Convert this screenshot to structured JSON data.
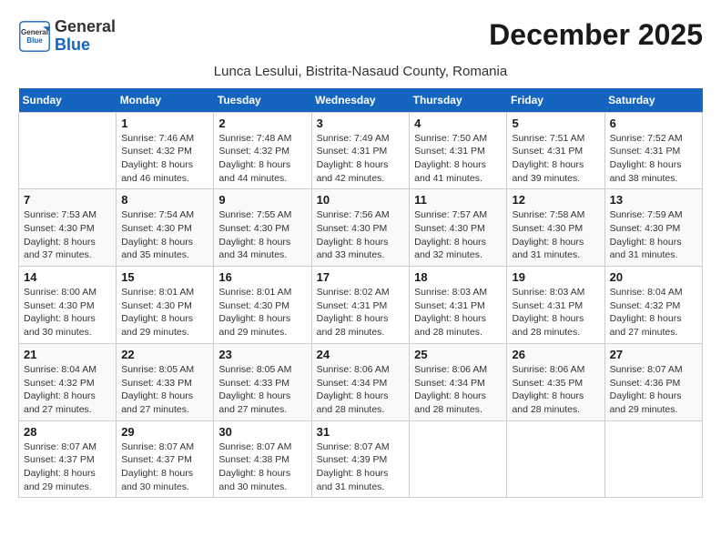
{
  "header": {
    "logo_general": "General",
    "logo_blue": "Blue",
    "month_title": "December 2025",
    "location": "Lunca Lesului, Bistrita-Nasaud County, Romania"
  },
  "weekdays": [
    "Sunday",
    "Monday",
    "Tuesday",
    "Wednesday",
    "Thursday",
    "Friday",
    "Saturday"
  ],
  "weeks": [
    [
      {
        "day": "",
        "info": ""
      },
      {
        "day": "1",
        "info": "Sunrise: 7:46 AM\nSunset: 4:32 PM\nDaylight: 8 hours\nand 46 minutes."
      },
      {
        "day": "2",
        "info": "Sunrise: 7:48 AM\nSunset: 4:32 PM\nDaylight: 8 hours\nand 44 minutes."
      },
      {
        "day": "3",
        "info": "Sunrise: 7:49 AM\nSunset: 4:31 PM\nDaylight: 8 hours\nand 42 minutes."
      },
      {
        "day": "4",
        "info": "Sunrise: 7:50 AM\nSunset: 4:31 PM\nDaylight: 8 hours\nand 41 minutes."
      },
      {
        "day": "5",
        "info": "Sunrise: 7:51 AM\nSunset: 4:31 PM\nDaylight: 8 hours\nand 39 minutes."
      },
      {
        "day": "6",
        "info": "Sunrise: 7:52 AM\nSunset: 4:31 PM\nDaylight: 8 hours\nand 38 minutes."
      }
    ],
    [
      {
        "day": "7",
        "info": "Sunrise: 7:53 AM\nSunset: 4:30 PM\nDaylight: 8 hours\nand 37 minutes."
      },
      {
        "day": "8",
        "info": "Sunrise: 7:54 AM\nSunset: 4:30 PM\nDaylight: 8 hours\nand 35 minutes."
      },
      {
        "day": "9",
        "info": "Sunrise: 7:55 AM\nSunset: 4:30 PM\nDaylight: 8 hours\nand 34 minutes."
      },
      {
        "day": "10",
        "info": "Sunrise: 7:56 AM\nSunset: 4:30 PM\nDaylight: 8 hours\nand 33 minutes."
      },
      {
        "day": "11",
        "info": "Sunrise: 7:57 AM\nSunset: 4:30 PM\nDaylight: 8 hours\nand 32 minutes."
      },
      {
        "day": "12",
        "info": "Sunrise: 7:58 AM\nSunset: 4:30 PM\nDaylight: 8 hours\nand 31 minutes."
      },
      {
        "day": "13",
        "info": "Sunrise: 7:59 AM\nSunset: 4:30 PM\nDaylight: 8 hours\nand 31 minutes."
      }
    ],
    [
      {
        "day": "14",
        "info": "Sunrise: 8:00 AM\nSunset: 4:30 PM\nDaylight: 8 hours\nand 30 minutes."
      },
      {
        "day": "15",
        "info": "Sunrise: 8:01 AM\nSunset: 4:30 PM\nDaylight: 8 hours\nand 29 minutes."
      },
      {
        "day": "16",
        "info": "Sunrise: 8:01 AM\nSunset: 4:30 PM\nDaylight: 8 hours\nand 29 minutes."
      },
      {
        "day": "17",
        "info": "Sunrise: 8:02 AM\nSunset: 4:31 PM\nDaylight: 8 hours\nand 28 minutes."
      },
      {
        "day": "18",
        "info": "Sunrise: 8:03 AM\nSunset: 4:31 PM\nDaylight: 8 hours\nand 28 minutes."
      },
      {
        "day": "19",
        "info": "Sunrise: 8:03 AM\nSunset: 4:31 PM\nDaylight: 8 hours\nand 28 minutes."
      },
      {
        "day": "20",
        "info": "Sunrise: 8:04 AM\nSunset: 4:32 PM\nDaylight: 8 hours\nand 27 minutes."
      }
    ],
    [
      {
        "day": "21",
        "info": "Sunrise: 8:04 AM\nSunset: 4:32 PM\nDaylight: 8 hours\nand 27 minutes."
      },
      {
        "day": "22",
        "info": "Sunrise: 8:05 AM\nSunset: 4:33 PM\nDaylight: 8 hours\nand 27 minutes."
      },
      {
        "day": "23",
        "info": "Sunrise: 8:05 AM\nSunset: 4:33 PM\nDaylight: 8 hours\nand 27 minutes."
      },
      {
        "day": "24",
        "info": "Sunrise: 8:06 AM\nSunset: 4:34 PM\nDaylight: 8 hours\nand 28 minutes."
      },
      {
        "day": "25",
        "info": "Sunrise: 8:06 AM\nSunset: 4:34 PM\nDaylight: 8 hours\nand 28 minutes."
      },
      {
        "day": "26",
        "info": "Sunrise: 8:06 AM\nSunset: 4:35 PM\nDaylight: 8 hours\nand 28 minutes."
      },
      {
        "day": "27",
        "info": "Sunrise: 8:07 AM\nSunset: 4:36 PM\nDaylight: 8 hours\nand 29 minutes."
      }
    ],
    [
      {
        "day": "28",
        "info": "Sunrise: 8:07 AM\nSunset: 4:37 PM\nDaylight: 8 hours\nand 29 minutes."
      },
      {
        "day": "29",
        "info": "Sunrise: 8:07 AM\nSunset: 4:37 PM\nDaylight: 8 hours\nand 30 minutes."
      },
      {
        "day": "30",
        "info": "Sunrise: 8:07 AM\nSunset: 4:38 PM\nDaylight: 8 hours\nand 30 minutes."
      },
      {
        "day": "31",
        "info": "Sunrise: 8:07 AM\nSunset: 4:39 PM\nDaylight: 8 hours\nand 31 minutes."
      },
      {
        "day": "",
        "info": ""
      },
      {
        "day": "",
        "info": ""
      },
      {
        "day": "",
        "info": ""
      }
    ]
  ]
}
